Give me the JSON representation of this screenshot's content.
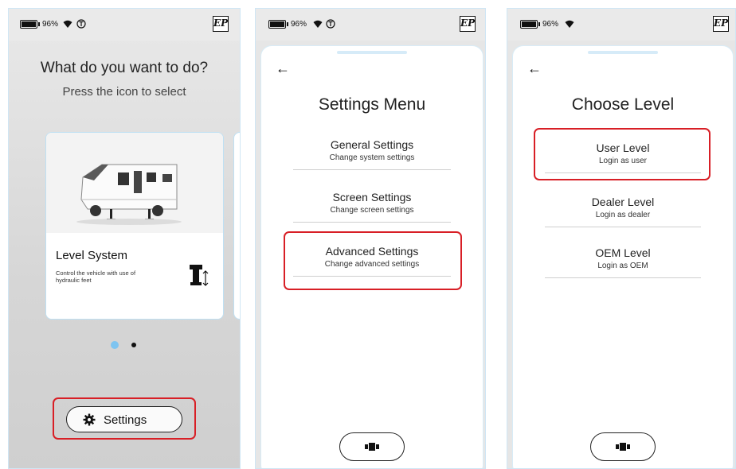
{
  "status": {
    "battery_percent": "96%",
    "logo_text": "EP"
  },
  "screen1": {
    "title": "What do you want to do?",
    "subtitle": "Press the icon to select",
    "card": {
      "title": "Level System",
      "description": "Control the vehicle with use of hydraulic feet"
    },
    "carousel": {
      "pages": 2,
      "active": 1
    },
    "settings_button": "Settings"
  },
  "screen2": {
    "back": "←",
    "title": "Settings Menu",
    "items": [
      {
        "title": "General Settings",
        "subtitle": "Change system settings"
      },
      {
        "title": "Screen Settings",
        "subtitle": "Change screen settings"
      },
      {
        "title": "Advanced Settings",
        "subtitle": "Change advanced settings"
      }
    ]
  },
  "screen3": {
    "back": "←",
    "title": "Choose Level",
    "items": [
      {
        "title": "User Level",
        "subtitle": "Login as user"
      },
      {
        "title": "Dealer Level",
        "subtitle": "Login as dealer"
      },
      {
        "title": "OEM Level",
        "subtitle": "Login as OEM"
      }
    ]
  },
  "colors": {
    "highlight": "#d81f26",
    "active_dot": "#7ec4f0",
    "card_border": "#bfe0f3"
  },
  "icons": [
    "battery-icon",
    "wifi-icon",
    "status-circle-icon",
    "ep-logo",
    "camper-van-image",
    "hydraulic-foot-icon",
    "gear-icon",
    "leveling-icon",
    "back-arrow-icon"
  ]
}
